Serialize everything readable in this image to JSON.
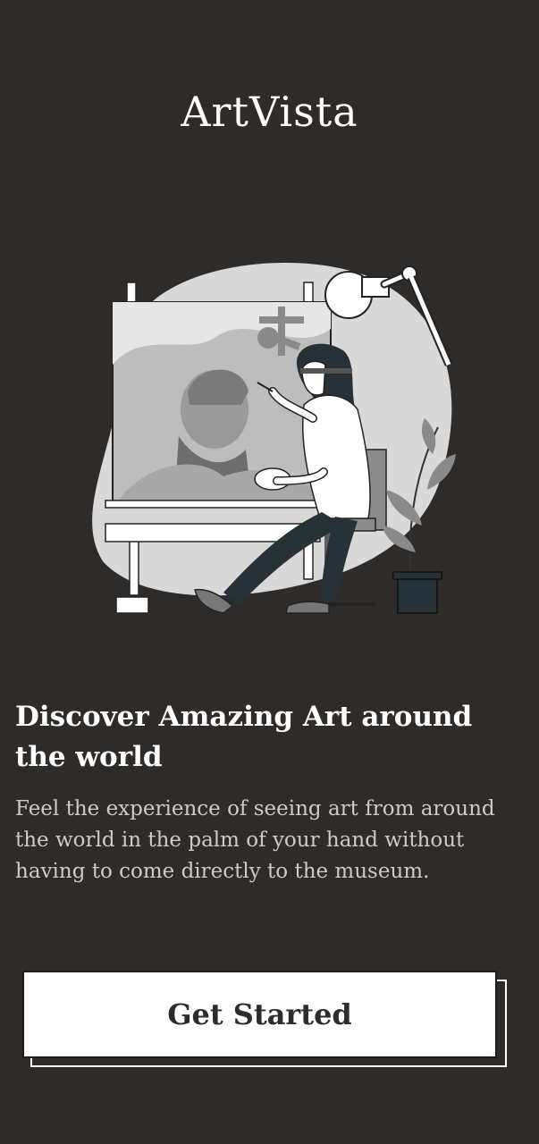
{
  "app": {
    "logo": "ArtVista"
  },
  "onboarding": {
    "headline": "Discover Amazing Art around the world",
    "description": "Feel the experience of seeing art from around the world in the palm of your hand without having to come directly to the museum.",
    "cta_label": "Get Started"
  },
  "illustration": {
    "icon": "artist-painting-illustration"
  },
  "colors": {
    "background": "#2f2b28",
    "text": "#ffffff",
    "muted_text": "#cfcac5",
    "button_bg": "#ffffff",
    "button_text": "#2f2b28"
  }
}
